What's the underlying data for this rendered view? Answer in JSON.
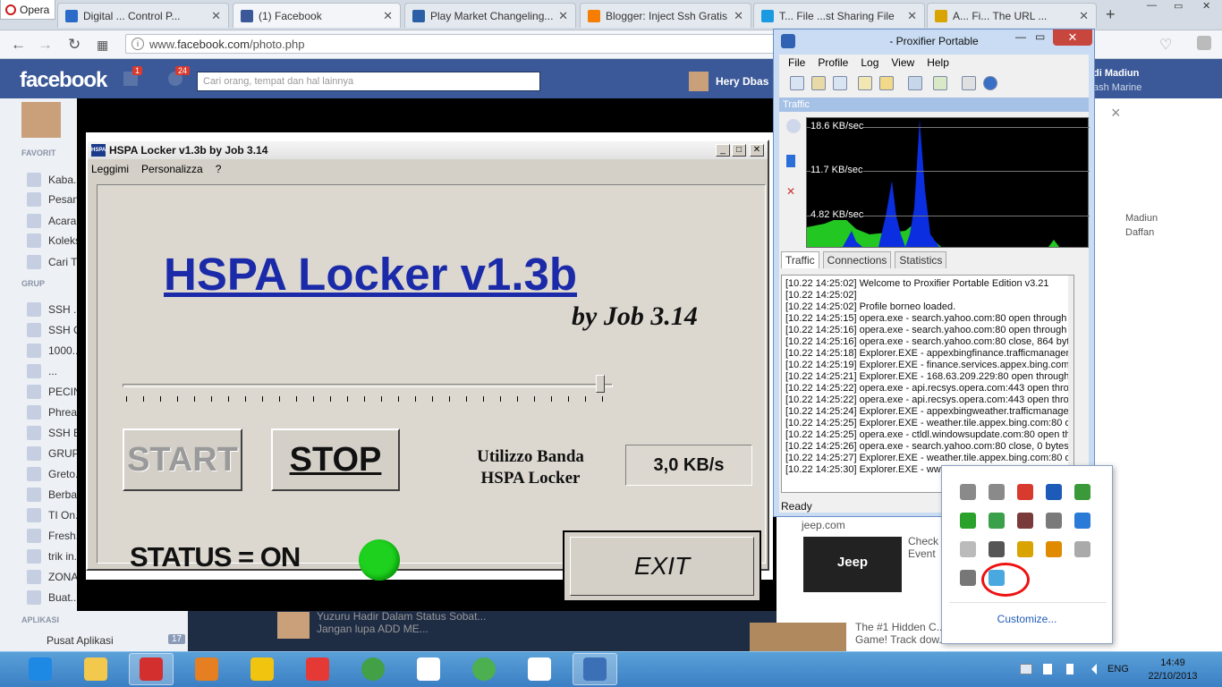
{
  "browser": {
    "menu_label": "Opera",
    "tabs": [
      {
        "label": "Digital ... Control P...",
        "icon": "opera-doc-icon",
        "color": "#2a6ac8"
      },
      {
        "label": "(1) Facebook",
        "icon": "facebook-icon",
        "color": "#3b5998"
      },
      {
        "label": "Play Market Changeling...",
        "icon": "play-market-icon",
        "color": "#2a5fa8"
      },
      {
        "label": "Blogger: Inject Ssh Gratis ...",
        "icon": "blogger-icon",
        "color": "#f57d00"
      },
      {
        "label": "T... File ...st Sharing File",
        "icon": "file-share-icon",
        "color": "#1a9ae0"
      },
      {
        "label": "A... Fi... The URL ...",
        "icon": "pages-icon",
        "color": "#d9a300"
      }
    ],
    "url_prefix": "www.",
    "url_domain": "facebook.com",
    "url_path": "/photo.php"
  },
  "facebook": {
    "logo": "facebook",
    "notif_count": "24",
    "friend_count": "1",
    "search_placeholder": "Cari orang, tempat dan hal lainnya",
    "user_name": "Hery Dbas",
    "sidebar_head_fav": "FAVORIT",
    "sidebar_head_group": "GRUP",
    "sidebar_head_apps": "APLIKASI",
    "sidebar_items": [
      "Kaba...",
      "Pesan",
      "Acara",
      "Koleks...",
      "Cari T...",
      "SSH ...",
      "SSH C...",
      "1000...",
      "...",
      "PECIN...",
      "Phrea...",
      "SSH B...",
      "GRUP...",
      "Greto...",
      "Berba...",
      "TI On...",
      "Fresh...",
      "trik in...",
      "ZONA...",
      "Buat..."
    ],
    "apps_item": "Pusat Aplikasi",
    "apps_count": "17",
    "right_text": [
      "di Madiun",
      "ash Marine",
      "Madiun",
      "Daffan",
      "jeep.com",
      "Check",
      "Event",
      "The #1 Hidden C...",
      "Game! Track dow...",
      "Yuzuru Hadir Dalam Status Sobat...",
      "Jangan lupa ADD ME..."
    ],
    "photo_close": "×"
  },
  "hspa": {
    "title": "HSPA Locker v1.3b  by Job 3.14",
    "menu": [
      "Leggimi",
      "Personalizza",
      "?"
    ],
    "heading": "HSPA Locker v1.3b",
    "byline": "by  Job 3.14",
    "start_label": "START",
    "stop_label": "STOP",
    "bandwidth_label_1": "Utilizzo Banda",
    "bandwidth_label_2": "HSPA Locker",
    "speed": "3,0 KB/s",
    "status": "STATUS = ON",
    "exit_label": "EXIT",
    "slider_value": 0.99
  },
  "proxifier": {
    "title": "- Proxifier Portable",
    "menu": [
      "File",
      "Profile",
      "Log",
      "View",
      "Help"
    ],
    "traffic_header": "Traffic",
    "graph_labels": [
      "18.6 KB/sec",
      "11.7 KB/sec",
      "4.82 KB/sec"
    ],
    "tabs": [
      "Traffic",
      "Connections",
      "Statistics"
    ],
    "log": [
      "[10.22 14:25:02]     Welcome to Proxifier Portable Edition v3.21",
      "[10.22 14:25:02]",
      "[10.22 14:25:02] Profile borneo loaded.",
      "[10.22 14:25:15] opera.exe - search.yahoo.com:80 open through ar",
      "[10.22 14:25:16] opera.exe - search.yahoo.com:80 open through ar",
      "[10.22 14:25:16] opera.exe - search.yahoo.com:80 close, 864 bytes",
      "[10.22 14:25:18] Explorer.EXE - appexbingfinance.trafficmanager.n",
      "[10.22 14:25:19] Explorer.EXE - finance.services.appex.bing.com:8",
      "[10.22 14:25:21] Explorer.EXE - 168.63.209.229:80 open through a",
      "[10.22 14:25:22] opera.exe - api.recsys.opera.com:443 open throug",
      "[10.22 14:25:22] opera.exe - api.recsys.opera.com:443 open throug",
      "[10.22 14:25:24] Explorer.EXE - appexbingweather.trafficmanager.n",
      "[10.22 14:25:25] Explorer.EXE - weather.tile.appex.bing.com:80 ope",
      "[10.22 14:25:25] opera.exe - ctldl.windowsupdate.com:80 open thro",
      "[10.22 14:25:26] opera.exe - search.yahoo.com:80 close, 0 bytes se",
      "[10.22 14:25:27] Explorer.EXE - weather.tile.appex.bing.com:80 ope",
      "[10.22 14:25:30] Explorer.EXE - ww"
    ],
    "status": "Ready"
  },
  "tray": {
    "customize_label": "Customize...",
    "icons": [
      "satellite-icon",
      "satellite-icon",
      "adobe-reader-icon",
      "bluetooth-icon",
      "usb-safely-remove-icon",
      "green-triangle-icon",
      "green-orb-icon",
      "network-guard-icon",
      "gray-box-icon",
      "globe-icon",
      "numbers-icon",
      "monitor-icon",
      "proxifier-tray-icon",
      "pencil-icon",
      "smiley-icon",
      "display-icon",
      "hspa-locker-tray-icon"
    ]
  },
  "taskbar": {
    "apps": [
      "internet-explorer-icon",
      "file-explorer-icon",
      "opera-icon",
      "firefox-icon",
      "proxifier-icon",
      "flag-icon",
      "chrome-icon",
      "unknown-app-icon",
      "green-app-icon",
      "unknown-app-icon-2",
      "network-app-icon"
    ],
    "language": "ENG",
    "time": "14:49",
    "date": "22/10/2013"
  }
}
